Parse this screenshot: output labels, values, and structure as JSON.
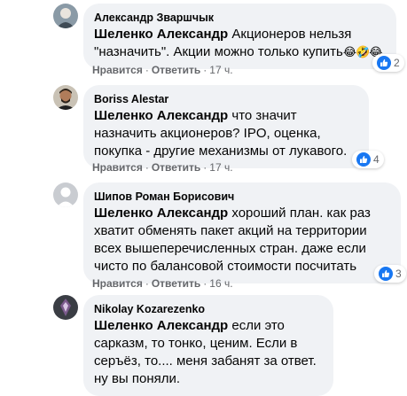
{
  "comments": [
    {
      "author": "Александр Зваршчык",
      "mention": "Шеленко Александр",
      "text": " Акционеров нельзя \"назначить\". Акции можно только купить",
      "emoji": "😂🤣😂",
      "like_label": "Нравится",
      "reply_label": "Ответить",
      "time": "17 ч.",
      "reaction_count": "2",
      "reaction_icon": "like-icon"
    },
    {
      "author": "Boriss Alestar",
      "mention": "Шеленко Александр",
      "text": " что значит назначить акционеров? IPO, оценка, покупка - другие механизмы от лукавого.",
      "like_label": "Нравится",
      "reply_label": "Ответить",
      "time": "17 ч.",
      "reaction_count": "4",
      "reaction_icon": "like-icon"
    },
    {
      "author": "Шипов Роман Борисович",
      "mention": "Шеленко Александр",
      "text": " хороший план. как раз хватит обменять пакет акций на территории всех вышеперечисленных стран. даже если чисто по балансовой стоимости посчитать",
      "like_label": "Нравится",
      "reply_label": "Ответить",
      "time": "16 ч.",
      "reaction_count": "3",
      "reaction_icon": "like-icon"
    },
    {
      "author": "Nikolay Kozarezenko",
      "mention": "Шеленко Александр",
      "text": " если это сарказм, то тонко, ценим. Если в серъёз, то.... меня забанят за ответ. ну вы поняли."
    }
  ],
  "colors": {
    "bubble": "#f0f2f5",
    "meta_text": "#65676b",
    "like_blue": "#1877f2"
  }
}
